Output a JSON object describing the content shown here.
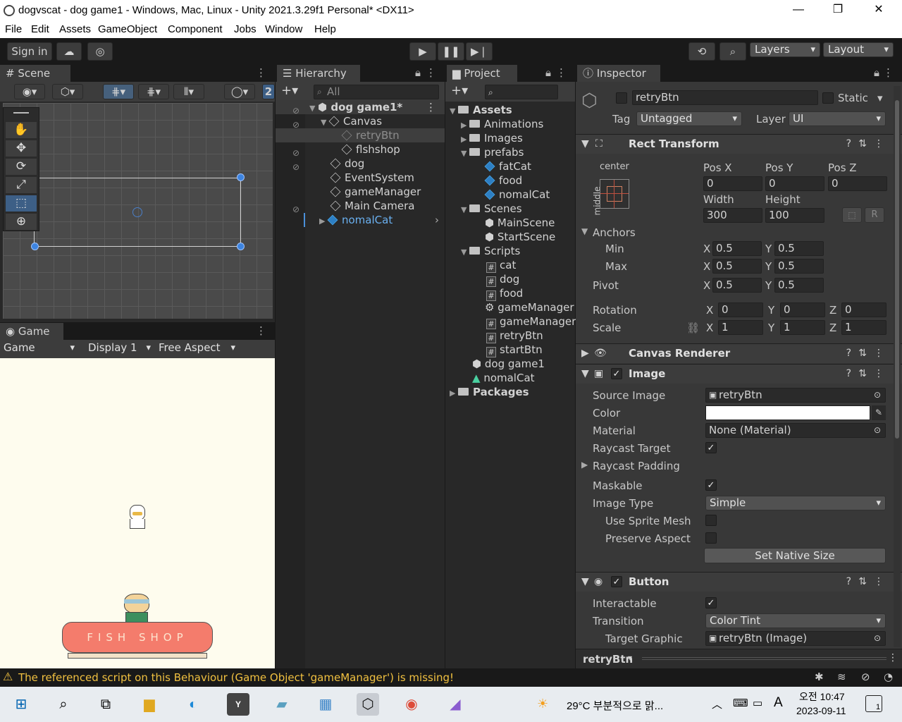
{
  "window": {
    "title": "dogvscat - dog game1 - Windows, Mac, Linux - Unity 2021.3.29f1 Personal* <DX11>"
  },
  "menu": [
    "File",
    "Edit",
    "Assets",
    "GameObject",
    "Component",
    "Jobs",
    "Window",
    "Help"
  ],
  "toolbar": {
    "signin": "Sign in",
    "layers": "Layers",
    "layout": "Layout"
  },
  "scene": {
    "tab": "Scene",
    "num": "2"
  },
  "game": {
    "tab": "Game",
    "mode": "Game",
    "display": "Display 1",
    "aspect": "Free Aspect",
    "sign": "FISH  SHOP"
  },
  "hierarchy": {
    "tab": "Hierarchy",
    "search": "All",
    "items": [
      "dog game1*",
      "Canvas",
      "retryBtn",
      "flshshop",
      "dog",
      "EventSystem",
      "gameManager",
      "Main Camera",
      "nomalCat"
    ]
  },
  "project": {
    "tab": "Project",
    "items": [
      "Assets",
      "Animations",
      "Images",
      "prefabs",
      "fatCat",
      "food",
      "nomalCat",
      "Scenes",
      "MainScene",
      "StartScene",
      "Scripts",
      "cat",
      "dog",
      "food",
      "gameManager",
      "gameManager",
      "retryBtn",
      "startBtn",
      "dog game1",
      "nomalCat",
      "Packages"
    ]
  },
  "inspector": {
    "tab": "Inspector",
    "name": "retryBtn",
    "static": "Static",
    "tag_label": "Tag",
    "tag": "Untagged",
    "layer_label": "Layer",
    "layer": "UI",
    "rect": {
      "title": "Rect Transform",
      "anchor_h": "center",
      "anchor_v": "middle",
      "posx_l": "Pos X",
      "posy_l": "Pos Y",
      "posz_l": "Pos Z",
      "posx": "0",
      "posy": "0",
      "posz": "0",
      "w_l": "Width",
      "h_l": "Height",
      "w": "300",
      "h": "100",
      "r_btn": "R",
      "anchors": "Anchors",
      "min": "Min",
      "max": "Max",
      "pivot": "Pivot",
      "x": "X",
      "y": "Y",
      "z": "Z",
      "min_x": "0.5",
      "min_y": "0.5",
      "max_x": "0.5",
      "max_y": "0.5",
      "pivot_x": "0.5",
      "pivot_y": "0.5",
      "rotation": "Rotation",
      "scale": "Scale",
      "rot_x": "0",
      "rot_y": "0",
      "rot_z": "0",
      "sc_x": "1",
      "sc_y": "1",
      "sc_z": "1"
    },
    "canvas_renderer": "Canvas Renderer",
    "image": {
      "title": "Image",
      "source_l": "Source Image",
      "source": "retryBtn",
      "color_l": "Color",
      "material_l": "Material",
      "material": "None (Material)",
      "raycast_l": "Raycast Target",
      "padding_l": "Raycast Padding",
      "maskable_l": "Maskable",
      "type_l": "Image Type",
      "type": "Simple",
      "sprite_mesh_l": "Use Sprite Mesh",
      "preserve_l": "Preserve Aspect",
      "native": "Set Native Size"
    },
    "button": {
      "title": "Button",
      "interact_l": "Interactable",
      "transition_l": "Transition",
      "transition": "Color Tint",
      "target_l": "Target Graphic",
      "target": "retryBtn (Image)"
    },
    "footer": "retryBtn"
  },
  "status": {
    "message": "The referenced script on this Behaviour (Game Object 'gameManager') is missing!"
  },
  "taskbar": {
    "weather": "29°C  부분적으로 맑...",
    "time": "오전 10:47",
    "date": "2023-09-11",
    "notif": "1"
  }
}
